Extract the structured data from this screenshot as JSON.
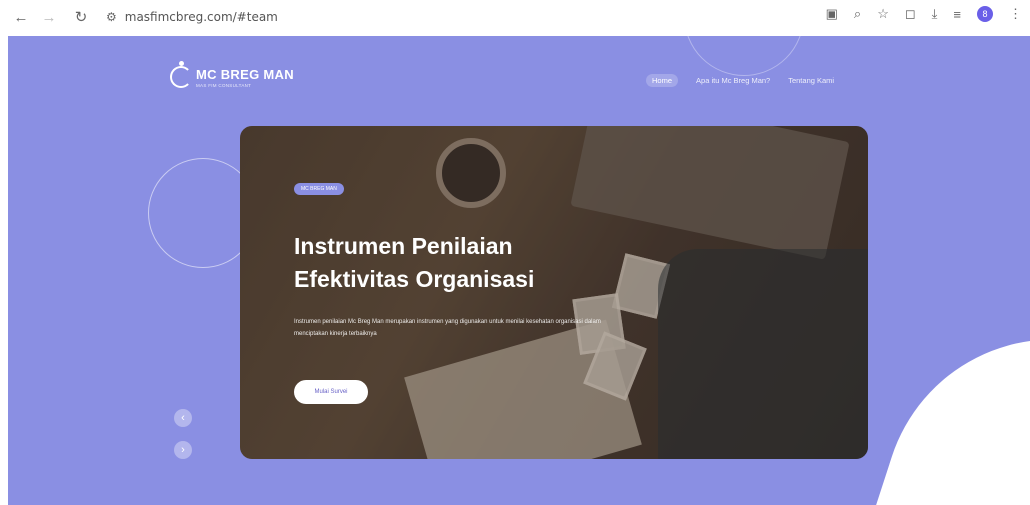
{
  "browser": {
    "url": "masfimcbreg.com/#team",
    "profile_initial": "8"
  },
  "nav": {
    "logo_name": "MC BREG MAN",
    "logo_sub": "MAS FIM CONSULTANT",
    "links": [
      "Home",
      "Apa itu Mc Breg Man?",
      "Tentang Kami"
    ]
  },
  "hero": {
    "badge": "MC BREG MAN",
    "title_line1": "Instrumen Penilaian",
    "title_line2": "Efektivitas Organisasi",
    "description": "Instrumen penilaian Mc Breg Man merupakan instrumen yang digunakan untuk menilai kesehatan organisasi dalam menciptakan kinerja terbaiknya",
    "cta_label": "Mulai Survei"
  },
  "carousel": {
    "prev_icon": "chevron-left-icon",
    "next_icon": "chevron-right-icon"
  },
  "colors": {
    "background": "#8a8fe3",
    "accent": "#6a63c7"
  }
}
